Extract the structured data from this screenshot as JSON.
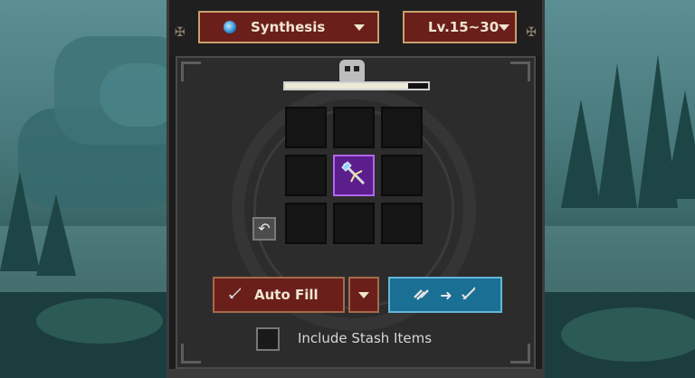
{
  "header": {
    "synthesis_dropdown": {
      "label": "Synthesis",
      "icon": "blue-orb-icon"
    },
    "level_dropdown": {
      "label": "Lv.15~30"
    }
  },
  "synthesis": {
    "progress_fraction": 0.86,
    "grid_slots": [
      {
        "filled": false
      },
      {
        "filled": false
      },
      {
        "filled": false
      },
      {
        "filled": false
      },
      {
        "filled": true,
        "item": "spear-icon"
      },
      {
        "filled": false
      },
      {
        "filled": false
      },
      {
        "filled": false
      },
      {
        "filled": false
      }
    ]
  },
  "actions": {
    "auto_fill_label": "Auto Fill",
    "synthesize_icons": [
      "bones-icon",
      "arrow-icon",
      "sword-icon"
    ]
  },
  "options": {
    "include_stash_label": "Include Stash Items",
    "include_stash_checked": false
  },
  "colors": {
    "dropdown_bg": "#6a1f1b",
    "gold_border": "#c9a06a",
    "synth_button": "#1a6f94",
    "epic_slot": "#5b1e8c"
  }
}
